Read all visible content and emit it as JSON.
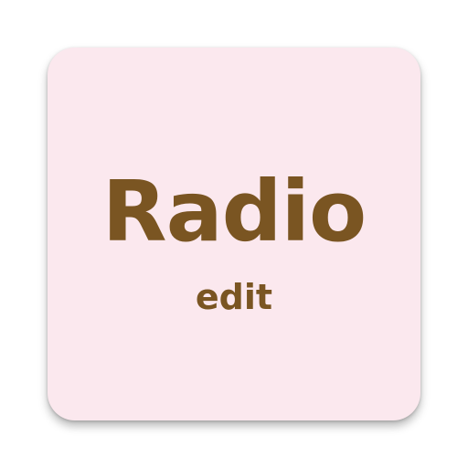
{
  "app_icon": {
    "title": "Radio",
    "subtitle": "edit",
    "background_color": "#fbe8ee",
    "text_color": "#7a5522"
  }
}
